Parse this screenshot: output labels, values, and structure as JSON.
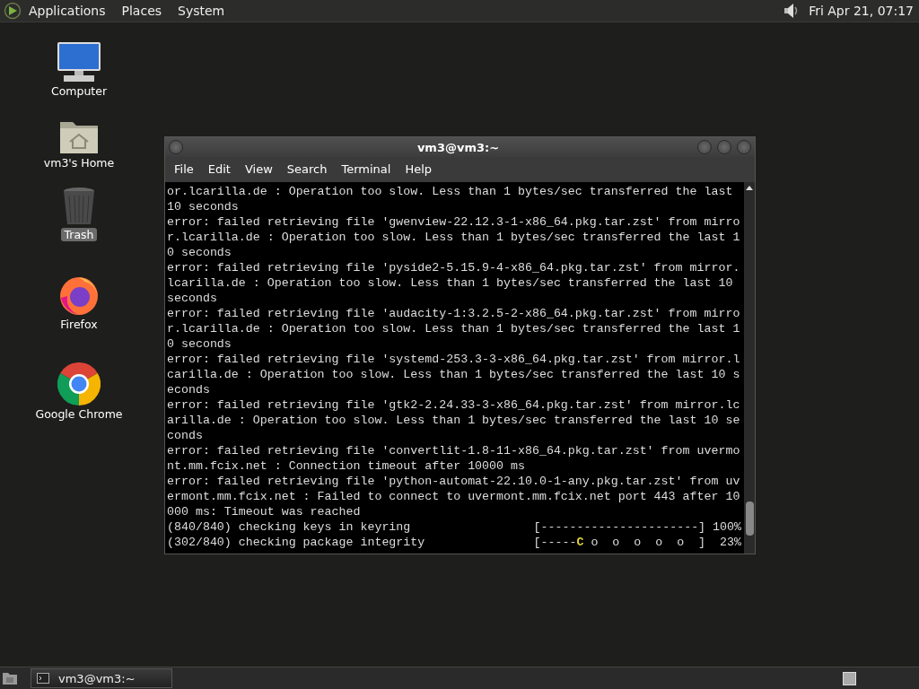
{
  "top_panel": {
    "menus": [
      "Applications",
      "Places",
      "System"
    ],
    "clock": "Fri Apr 21, 07:17"
  },
  "desktop_icons": [
    {
      "kind": "computer",
      "label": "Computer",
      "selected": false
    },
    {
      "kind": "home",
      "label": "vm3's Home",
      "selected": false
    },
    {
      "kind": "trash",
      "label": "Trash",
      "selected": true
    },
    {
      "kind": "firefox",
      "label": "Firefox",
      "selected": false
    },
    {
      "kind": "chrome",
      "label": "Google Chrome",
      "selected": false
    }
  ],
  "terminal": {
    "title": "vm3@vm3:~",
    "menu": [
      "File",
      "Edit",
      "View",
      "Search",
      "Terminal",
      "Help"
    ],
    "lines": [
      {
        "kind": "text",
        "text": "or.lcarilla.de : Operation too slow. Less than 1 bytes/sec transferred the last"
      },
      {
        "kind": "text",
        "text": "10 seconds"
      },
      {
        "kind": "text",
        "text": "error: failed retrieving file 'gwenview-22.12.3-1-x86_64.pkg.tar.zst' from mirro"
      },
      {
        "kind": "text",
        "text": "r.lcarilla.de : Operation too slow. Less than 1 bytes/sec transferred the last 1"
      },
      {
        "kind": "text",
        "text": "0 seconds"
      },
      {
        "kind": "text",
        "text": "error: failed retrieving file 'pyside2-5.15.9-4-x86_64.pkg.tar.zst' from mirror."
      },
      {
        "kind": "text",
        "text": "lcarilla.de : Operation too slow. Less than 1 bytes/sec transferred the last 10"
      },
      {
        "kind": "text",
        "text": "seconds"
      },
      {
        "kind": "text",
        "text": "error: failed retrieving file 'audacity-1:3.2.5-2-x86_64.pkg.tar.zst' from mirro"
      },
      {
        "kind": "text",
        "text": "r.lcarilla.de : Operation too slow. Less than 1 bytes/sec transferred the last 1"
      },
      {
        "kind": "text",
        "text": "0 seconds"
      },
      {
        "kind": "text",
        "text": "error: failed retrieving file 'systemd-253.3-3-x86_64.pkg.tar.zst' from mirror.l"
      },
      {
        "kind": "text",
        "text": "carilla.de : Operation too slow. Less than 1 bytes/sec transferred the last 10 s"
      },
      {
        "kind": "text",
        "text": "econds"
      },
      {
        "kind": "text",
        "text": "error: failed retrieving file 'gtk2-2.24.33-3-x86_64.pkg.tar.zst' from mirror.lc"
      },
      {
        "kind": "text",
        "text": "arilla.de : Operation too slow. Less than 1 bytes/sec transferred the last 10 se"
      },
      {
        "kind": "text",
        "text": "conds"
      },
      {
        "kind": "text",
        "text": "error: failed retrieving file 'convertlit-1.8-11-x86_64.pkg.tar.zst' from uvermo"
      },
      {
        "kind": "text",
        "text": "nt.mm.fcix.net : Connection timeout after 10000 ms"
      },
      {
        "kind": "text",
        "text": "error: failed retrieving file 'python-automat-22.10.0-1-any.pkg.tar.zst' from uv"
      },
      {
        "kind": "text",
        "text": "ermont.mm.fcix.net : Failed to connect to uvermont.mm.fcix.net port 443 after 10"
      },
      {
        "kind": "text",
        "text": "000 ms: Timeout was reached"
      },
      {
        "kind": "progress",
        "label": "(840/840) checking keys in keyring",
        "bar_done": "[----------------------]",
        "percent": " 100%"
      },
      {
        "kind": "progress",
        "label": "(302/840) checking package integrity",
        "bar_done": "[-----",
        "pacman": "C",
        "bar_rest": " o  o  o  o  o  ]",
        "percent": "  23%"
      }
    ]
  },
  "taskbar": {
    "tasks": [
      {
        "label": "vm3@vm3:~",
        "selected": false
      }
    ]
  }
}
